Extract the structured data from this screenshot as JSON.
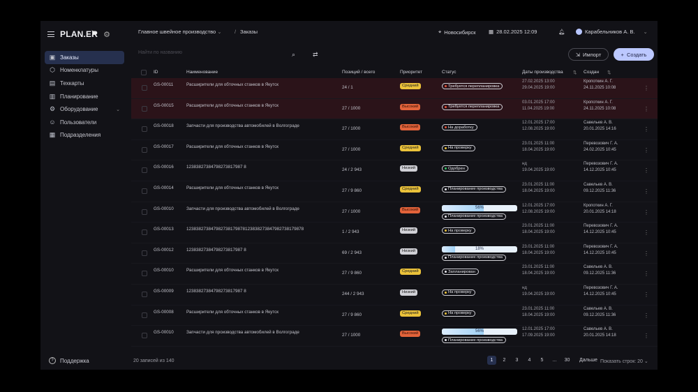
{
  "app": {
    "logo": "PLAN.ER"
  },
  "nav": [
    {
      "label": "Заказы",
      "icon": "orders-icon",
      "active": true
    },
    {
      "label": "Номенклатуры",
      "icon": "cube-icon"
    },
    {
      "label": "Техкарты",
      "icon": "techcard-icon"
    },
    {
      "label": "Планирование",
      "icon": "planning-icon"
    },
    {
      "label": "Оборудование",
      "icon": "equipment-icon"
    },
    {
      "label": "Пользователи",
      "icon": "user-icon"
    },
    {
      "label": "Подразделения",
      "icon": "departments-icon"
    }
  ],
  "support_label": "Поддержка",
  "header": {
    "workspace": "Главное швейное производство",
    "crumb_sep": "/",
    "crumb_current": "Заказы",
    "city": "Новосибирск",
    "datetime": "28.02.2025 12:09",
    "user": "Карабельников А. В."
  },
  "toolbar": {
    "search_placeholder": "Найти по названию",
    "import_label": "Импорт",
    "create_label": "Создать"
  },
  "table": {
    "headers": {
      "id": "ID",
      "name": "Наименование",
      "positions": "Позиций / всего",
      "priority": "Приоритет",
      "status": "Статус",
      "dates": "Даты производства",
      "created": "Создан"
    },
    "rows": [
      {
        "id": "GS-00011",
        "name": "Расширители для обточных станков в Якутск",
        "pos": "24 / 1",
        "prio": "Средний",
        "prio_level": "mid",
        "status": "Требуется перепланировка",
        "status_color": "#e0533a",
        "d1": "27.02.2025 13:00",
        "d2": "29.04.2025 19:00",
        "c1": "Кропоткин А. Г.",
        "c2": "24.11.2025 10:08",
        "red": true
      },
      {
        "id": "GS-00015",
        "name": "Расширители для обточных станков в Якутск",
        "pos": "27 / 1000",
        "prio": "Высокий",
        "prio_level": "high",
        "status": "Требуется перепланировка",
        "status_color": "#e0533a",
        "d1": "03.01.2025 17:00",
        "d2": "11.04.2025 19:00",
        "c1": "Кропоткин А. Г.",
        "c2": "24.11.2025 10:08",
        "red": true
      },
      {
        "id": "GS-00018",
        "name": "Запчасти для производства автомобилей в Волгограде",
        "pos": "27 / 1000",
        "prio": "Высокий",
        "prio_level": "high",
        "status": "На доработку",
        "status_color": "#e0533a",
        "d1": "12.01.2025 17:00",
        "d2": "12.08.2025 19:00",
        "c1": "Савельев А. В.",
        "c2": "20.01.2025 14:16"
      },
      {
        "id": "GS-00017",
        "name": "Расширители для обточных станков в Якутск",
        "pos": "27 / 1000",
        "prio": "Средний",
        "prio_level": "mid",
        "status": "На проверку",
        "status_color": "#ebc23a",
        "d1": "23.01.2025 11:00",
        "d2": "18.04.2025 19:00",
        "c1": "Перевозович Г. А.",
        "c2": "24.02.2025 10:45"
      },
      {
        "id": "GS-00016",
        "name": "12383827384798273817987 8",
        "pos": "24 / 2 943",
        "prio": "Низкий",
        "prio_level": "low",
        "status": "Одобрен",
        "status_color": "#3bc46a",
        "d1": "нд",
        "d2": "19.04.2025 19:00",
        "c1": "Перевозович Г. А.",
        "c2": "14.12.2025 10:45"
      },
      {
        "id": "GS-00014",
        "name": "Расширители для обточных станков в Якутск",
        "pos": "27 / 9 860",
        "prio": "Средний",
        "prio_level": "mid",
        "status": "Планирование производства",
        "status_color": "#e8e8ee",
        "d1": "23.01.2025 11:00",
        "d2": "18.04.2025 19:00",
        "c1": "Савельев А. В.",
        "c2": "09.12.2025 11:36"
      },
      {
        "id": "GS-00010",
        "name": "Запчасти для производства автомобилей в Волгограде",
        "pos": "27 / 1000",
        "prio": "Высокий",
        "prio_level": "high",
        "progress": 56,
        "status": "Планирование производства",
        "status_color": "#e8e8ee",
        "d1": "12.01.2025 17:00",
        "d2": "12.08.2025 19:00",
        "c1": "Кропоткин А. Г.",
        "c2": "20.01.2025 14:18"
      },
      {
        "id": "GS-00013",
        "name": "123838273847982738179878123838273847982738179878",
        "pos": "1 / 2 943",
        "prio": "Низкий",
        "prio_level": "low",
        "status": "На проверку",
        "status_color": "#ebc23a",
        "d1": "23.01.2025 11:00",
        "d2": "18.04.2025 19:00",
        "c1": "Перевозович Г. А.",
        "c2": "14.12.2025 10:45"
      },
      {
        "id": "GS-00012",
        "name": "12383827384798273817987 8",
        "pos": "69 / 2 943",
        "prio": "Низкий",
        "prio_level": "low",
        "progress": 18,
        "status": "Планирование производства",
        "status_color": "#e8e8ee",
        "d1": "23.01.2025 11:00",
        "d2": "18.04.2025 19:00",
        "c1": "Перевозович Г. А.",
        "c2": "14.12.2025 10:45"
      },
      {
        "id": "GS-00010",
        "name": "Расширители для обточных станков в Якутск",
        "pos": "27 / 9 860",
        "prio": "Средний",
        "prio_level": "mid",
        "status": "Запланирован",
        "status_color": "#e8e8ee",
        "d1": "23.01.2025 11:00",
        "d2": "18.04.2025 19:00",
        "c1": "Савельев А. В.",
        "c2": "09.12.2025 11:36"
      },
      {
        "id": "GS-00009",
        "name": "12383827384798273817987 8",
        "pos": "244 / 2 943",
        "prio": "Низкий",
        "prio_level": "low",
        "status": "На проверку",
        "status_color": "#ebc23a",
        "d1": "нд",
        "d2": "19.04.2025 19:00",
        "c1": "Перевозович Г. А.",
        "c2": "14.12.2025 10:45"
      },
      {
        "id": "GS-00008",
        "name": "Расширители для обточных станков в Якутск",
        "pos": "27 / 9 860",
        "prio": "Средний",
        "prio_level": "mid",
        "status": "На проверку",
        "status_color": "#ebc23a",
        "d1": "23.01.2025 11:00",
        "d2": "18.04.2025 19:00",
        "c1": "Савельев А. В.",
        "c2": "09.12.2025 11:36"
      },
      {
        "id": "GS-00010",
        "name": "Запчасти для производства автомобилей в Волгограде",
        "pos": "27 / 1000",
        "prio": "Высокий",
        "prio_level": "high",
        "progress": 56,
        "status": "Планирование производства",
        "status_color": "#e8e8ee",
        "d1": "12.01.2025 17:00",
        "d2": "17.09.2025 19:00",
        "c1": "Савельев А. В.",
        "c2": "20.01.2025 14:18"
      }
    ]
  },
  "footer": {
    "records": "20 записей из 140",
    "pages": [
      "1",
      "2",
      "3",
      "4",
      "5",
      "...",
      "30"
    ],
    "next_label": "Дальше",
    "rows_per_page": "Показать строк: 20"
  }
}
